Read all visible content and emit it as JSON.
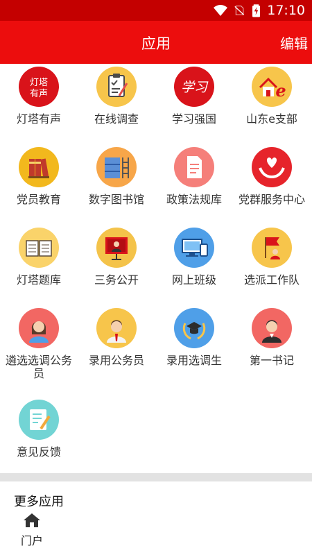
{
  "status_bar": {
    "time": "17:10",
    "icons": [
      "wifi-icon",
      "no-sim-icon",
      "battery-charging-icon"
    ]
  },
  "header": {
    "title": "应用",
    "edit_label": "编辑"
  },
  "apps": [
    {
      "label": "灯塔有声",
      "icon": "dengta-voice-icon",
      "color": "#d9131a",
      "glyph": "灯塔有声"
    },
    {
      "label": "在线调查",
      "icon": "survey-clipboard-icon",
      "color": "#f7c54b"
    },
    {
      "label": "学习强国",
      "icon": "xuexi-qiangguo-icon",
      "color": "#d9131a",
      "glyph": "学习"
    },
    {
      "label": "山东e支部",
      "icon": "house-e-icon",
      "color": "#f7c54b"
    },
    {
      "label": "党员教育",
      "icon": "books-icon",
      "color": "#f2b81d"
    },
    {
      "label": "数字图书馆",
      "icon": "bookshelf-ladder-icon",
      "color": "#f7a649"
    },
    {
      "label": "政策法规库",
      "icon": "document-icon",
      "color": "#f57f7a"
    },
    {
      "label": "党群服务中心",
      "icon": "heart-hands-icon",
      "color": "#e6242b"
    },
    {
      "label": "灯塔题库",
      "icon": "open-book-icon",
      "color": "#fad36a"
    },
    {
      "label": "三务公开",
      "icon": "presentation-board-icon",
      "color": "#f4c34a"
    },
    {
      "label": "网上班级",
      "icon": "computer-devices-icon",
      "color": "#4f9fe8"
    },
    {
      "label": "选派工作队",
      "icon": "flag-person-icon",
      "color": "#f7c54b"
    },
    {
      "label": "遴选选调公务员",
      "icon": "female-avatar-icon",
      "color": "#f26763"
    },
    {
      "label": "录用公务员",
      "icon": "male-avatar-icon",
      "color": "#f7c54b"
    },
    {
      "label": "录用选调生",
      "icon": "graduation-laurel-icon",
      "color": "#4f9fe8"
    },
    {
      "label": "第一书记",
      "icon": "suit-avatar-icon",
      "color": "#f26763"
    },
    {
      "label": "意见反馈",
      "icon": "feedback-note-icon",
      "color": "#72d4d4"
    }
  ],
  "more_section": {
    "title": "更多应用"
  },
  "bottom_nav": {
    "portal_label": "门户",
    "portal_icon": "home-icon"
  },
  "colors": {
    "status_bar": "#c40000",
    "header": "#ec0d0d",
    "divider": "#e2e2e2"
  }
}
